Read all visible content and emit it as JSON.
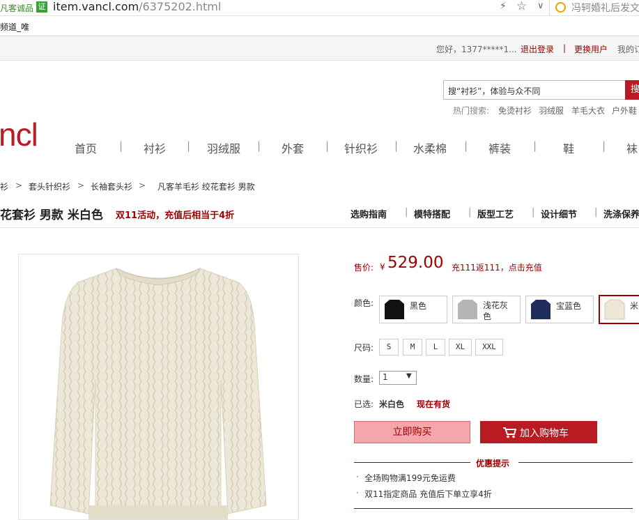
{
  "browser": {
    "trust_label": "凡客诚品",
    "trust_badge": "证",
    "url_host": "item.vancl.com",
    "url_path": "/6375202.html",
    "search_hint": "冯轲婚礼后发文",
    "bookmark": "频道_唯"
  },
  "topbar": {
    "greeting": "您好，1377*****1...",
    "logout": "退出登录",
    "sep": "|",
    "switch_user": "更换用户",
    "my_orders": "我的订"
  },
  "header": {
    "logo": "ncl",
    "search_placeholder": "搜“衬衫”，体验与众不同",
    "search_button": "搜",
    "hot_label": "热门搜索:",
    "hot_terms": [
      "免烫衬衫",
      "羽绒服",
      "羊毛大衣",
      "户外鞋"
    ]
  },
  "nav": [
    "首页",
    "衬衫",
    "羽绒服",
    "外套",
    "针织衫",
    "水柔棉",
    "裤装",
    "鞋",
    "袜"
  ],
  "breadcrumb": {
    "items": [
      "衫",
      "套头针织衫",
      "长袖套头衫",
      "凡客羊毛衫 绞花套衫 男款"
    ],
    "sep": ">"
  },
  "product": {
    "title": "花套衫 男款 米白色",
    "promo": "双11活动，充值后相当于4折",
    "tabs": [
      "选购指南",
      "模特搭配",
      "版型工艺",
      "设计细节",
      "洗涤保养"
    ],
    "price_label": "售价:",
    "currency": "¥",
    "price": "529.00",
    "price_note": "充111返111，点击充值",
    "color_label": "颜色:",
    "colors": [
      {
        "name": "黑色",
        "swatch": "#111111"
      },
      {
        "name": "浅花灰色",
        "swatch": "#b5b5b5"
      },
      {
        "name": "宝蓝色",
        "swatch": "#1f2d5c"
      },
      {
        "name": "米",
        "swatch": "#ece7d6"
      }
    ],
    "size_label": "尺码:",
    "sizes": [
      "S",
      "M",
      "L",
      "XL",
      "XXL"
    ],
    "qty_label": "数量:",
    "qty_value": "1",
    "selected_label": "已选:",
    "selected_value": "米白色",
    "stock": "现在有货",
    "buy_now": "立即购买",
    "add_cart": "加入购物车",
    "tips_title": "优惠提示",
    "tips": [
      "全场购物满199元免运费",
      "双11指定商品 充值后下单立享4折"
    ]
  },
  "colors": {
    "brand_red": "#a10000",
    "button_red": "#b81c22",
    "buy_pink": "#f4a6aa",
    "sweater": "#ece7d6"
  }
}
